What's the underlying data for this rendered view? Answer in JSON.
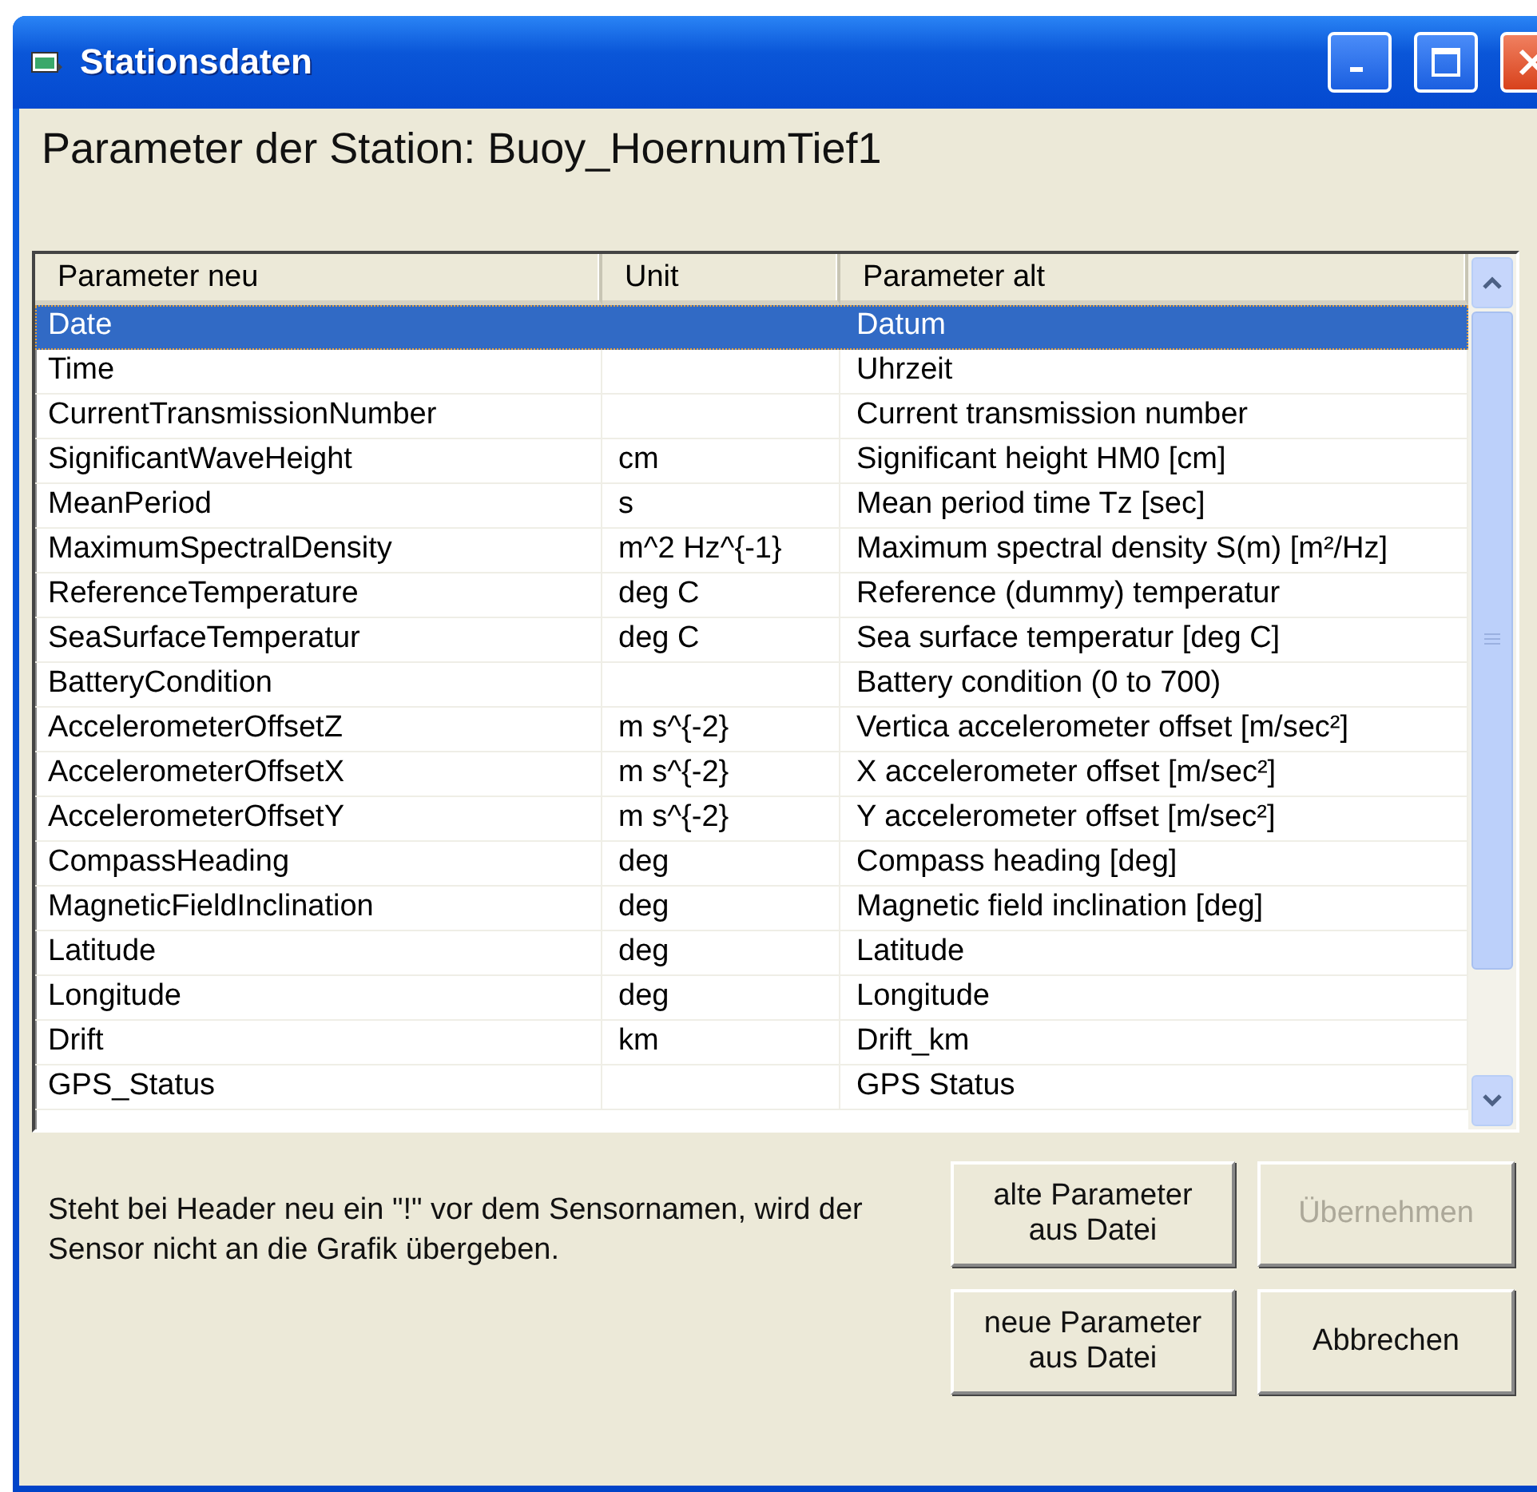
{
  "window": {
    "title": "Stationsdaten"
  },
  "heading": "Parameter der Station: Buoy_HoernumTief1",
  "table": {
    "columns": [
      "Parameter neu",
      "Unit",
      "Parameter alt"
    ],
    "rows": [
      {
        "cells": [
          "Date",
          "",
          "Datum"
        ],
        "selected": true
      },
      {
        "cells": [
          "Time",
          "",
          "Uhrzeit"
        ],
        "selected": false
      },
      {
        "cells": [
          "CurrentTransmissionNumber",
          "",
          "Current transmission number"
        ],
        "selected": false
      },
      {
        "cells": [
          "SignificantWaveHeight",
          "cm",
          "Significant height HM0 [cm]"
        ],
        "selected": false
      },
      {
        "cells": [
          "MeanPeriod",
          "s",
          "Mean period time Tz [sec]"
        ],
        "selected": false
      },
      {
        "cells": [
          "MaximumSpectralDensity",
          "m^2 Hz^{-1}",
          "Maximum spectral density S(m) [m²/Hz]"
        ],
        "selected": false
      },
      {
        "cells": [
          "ReferenceTemperature",
          "deg C",
          "Reference (dummy) temperatur"
        ],
        "selected": false
      },
      {
        "cells": [
          "SeaSurfaceTemperatur",
          "deg C",
          "Sea surface temperatur [deg C]"
        ],
        "selected": false
      },
      {
        "cells": [
          "BatteryCondition",
          "",
          "Battery condition (0 to 700)"
        ],
        "selected": false
      },
      {
        "cells": [
          "AccelerometerOffsetZ",
          "m s^{-2}",
          "Vertica accelerometer offset [m/sec²]"
        ],
        "selected": false
      },
      {
        "cells": [
          "AccelerometerOffsetX",
          "m s^{-2}",
          "X accelerometer offset [m/sec²]"
        ],
        "selected": false
      },
      {
        "cells": [
          "AccelerometerOffsetY",
          "m s^{-2}",
          "Y accelerometer offset [m/sec²]"
        ],
        "selected": false
      },
      {
        "cells": [
          "CompassHeading",
          "deg",
          "Compass heading [deg]"
        ],
        "selected": false
      },
      {
        "cells": [
          "MagneticFieldInclination",
          "deg",
          "Magnetic field inclination [deg]"
        ],
        "selected": false
      },
      {
        "cells": [
          "Latitude",
          "deg",
          "Latitude"
        ],
        "selected": false
      },
      {
        "cells": [
          "Longitude",
          "deg",
          "Longitude"
        ],
        "selected": false
      },
      {
        "cells": [
          "Drift",
          "km",
          "Drift_km"
        ],
        "selected": false
      },
      {
        "cells": [
          "GPS_Status",
          "",
          "GPS Status"
        ],
        "selected": false
      }
    ]
  },
  "note": "Steht bei Header neu ein \"!\" vor dem Sensornamen, wird der Sensor nicht an die Grafik übergeben.",
  "buttons": [
    {
      "label": "alte Parameter aus Datei",
      "disabled": false
    },
    {
      "label": "Übernehmen",
      "disabled": true
    },
    {
      "label": "neue Parameter aus Datei",
      "disabled": false
    },
    {
      "label": "Abbrechen",
      "disabled": false
    }
  ]
}
